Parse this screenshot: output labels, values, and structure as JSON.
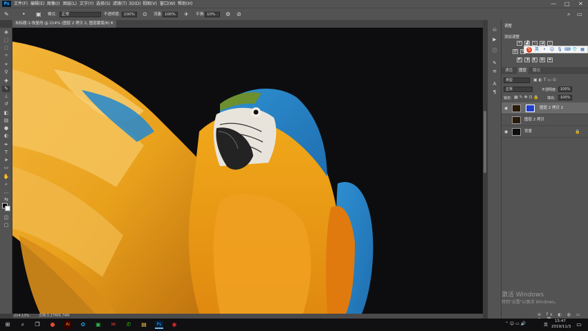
{
  "app": {
    "logo": "Ps"
  },
  "menu": [
    "文件(F)",
    "编辑(E)",
    "图像(I)",
    "图层(L)",
    "文字(Y)",
    "选择(S)",
    "滤镜(T)",
    "3D(D)",
    "视图(V)",
    "窗口(W)",
    "帮助(H)"
  ],
  "window_controls": [
    "—",
    "□",
    "✕"
  ],
  "options": {
    "mode_label": "模式:",
    "mode_value": "正常",
    "opacity_label": "不透明度:",
    "opacity_value": "100%",
    "flow_label": "流量:",
    "flow_value": "100%",
    "smooth_label": "平滑:",
    "smooth_value": "10%"
  },
  "document_tab": {
    "title": "未标题-1-恢复的 @ 214% (图层 2 拷贝 2, 图层蒙版/8) *",
    "close": "×"
  },
  "status": {
    "zoom": "214.13%",
    "doc": "文档:3.27M/6.74M"
  },
  "adjustments_panel": {
    "title": "调整",
    "subtitle": "添加调整"
  },
  "ime": {
    "logo": "S",
    "lang": "英"
  },
  "layers_panel": {
    "tabs": [
      "通道",
      "图层",
      "路径"
    ],
    "active_tab": "图层",
    "filter_kind": "类型",
    "blend_mode": "正常",
    "opacity_label": "不透明度:",
    "opacity_value": "100%",
    "lock_label": "锁定:",
    "fill_label": "填充:",
    "fill_value": "100%",
    "layers": [
      {
        "name": "图层 2 拷贝 2",
        "selected": true,
        "mask": true
      },
      {
        "name": "图层 2 拷贝",
        "selected": false,
        "mask": false
      },
      {
        "name": "背景",
        "selected": false,
        "mask": false,
        "locked": true
      }
    ]
  },
  "watermark": {
    "line1": "激活 Windows",
    "line2": "转到\"设置\"以激活 Windows。"
  },
  "taskbar": {
    "time": "15:47",
    "date": "2019/11/3",
    "lang": "英"
  },
  "colors": {
    "accent": "#31a8ff",
    "canvas": "#0d0d0f",
    "panel": "#535353"
  }
}
